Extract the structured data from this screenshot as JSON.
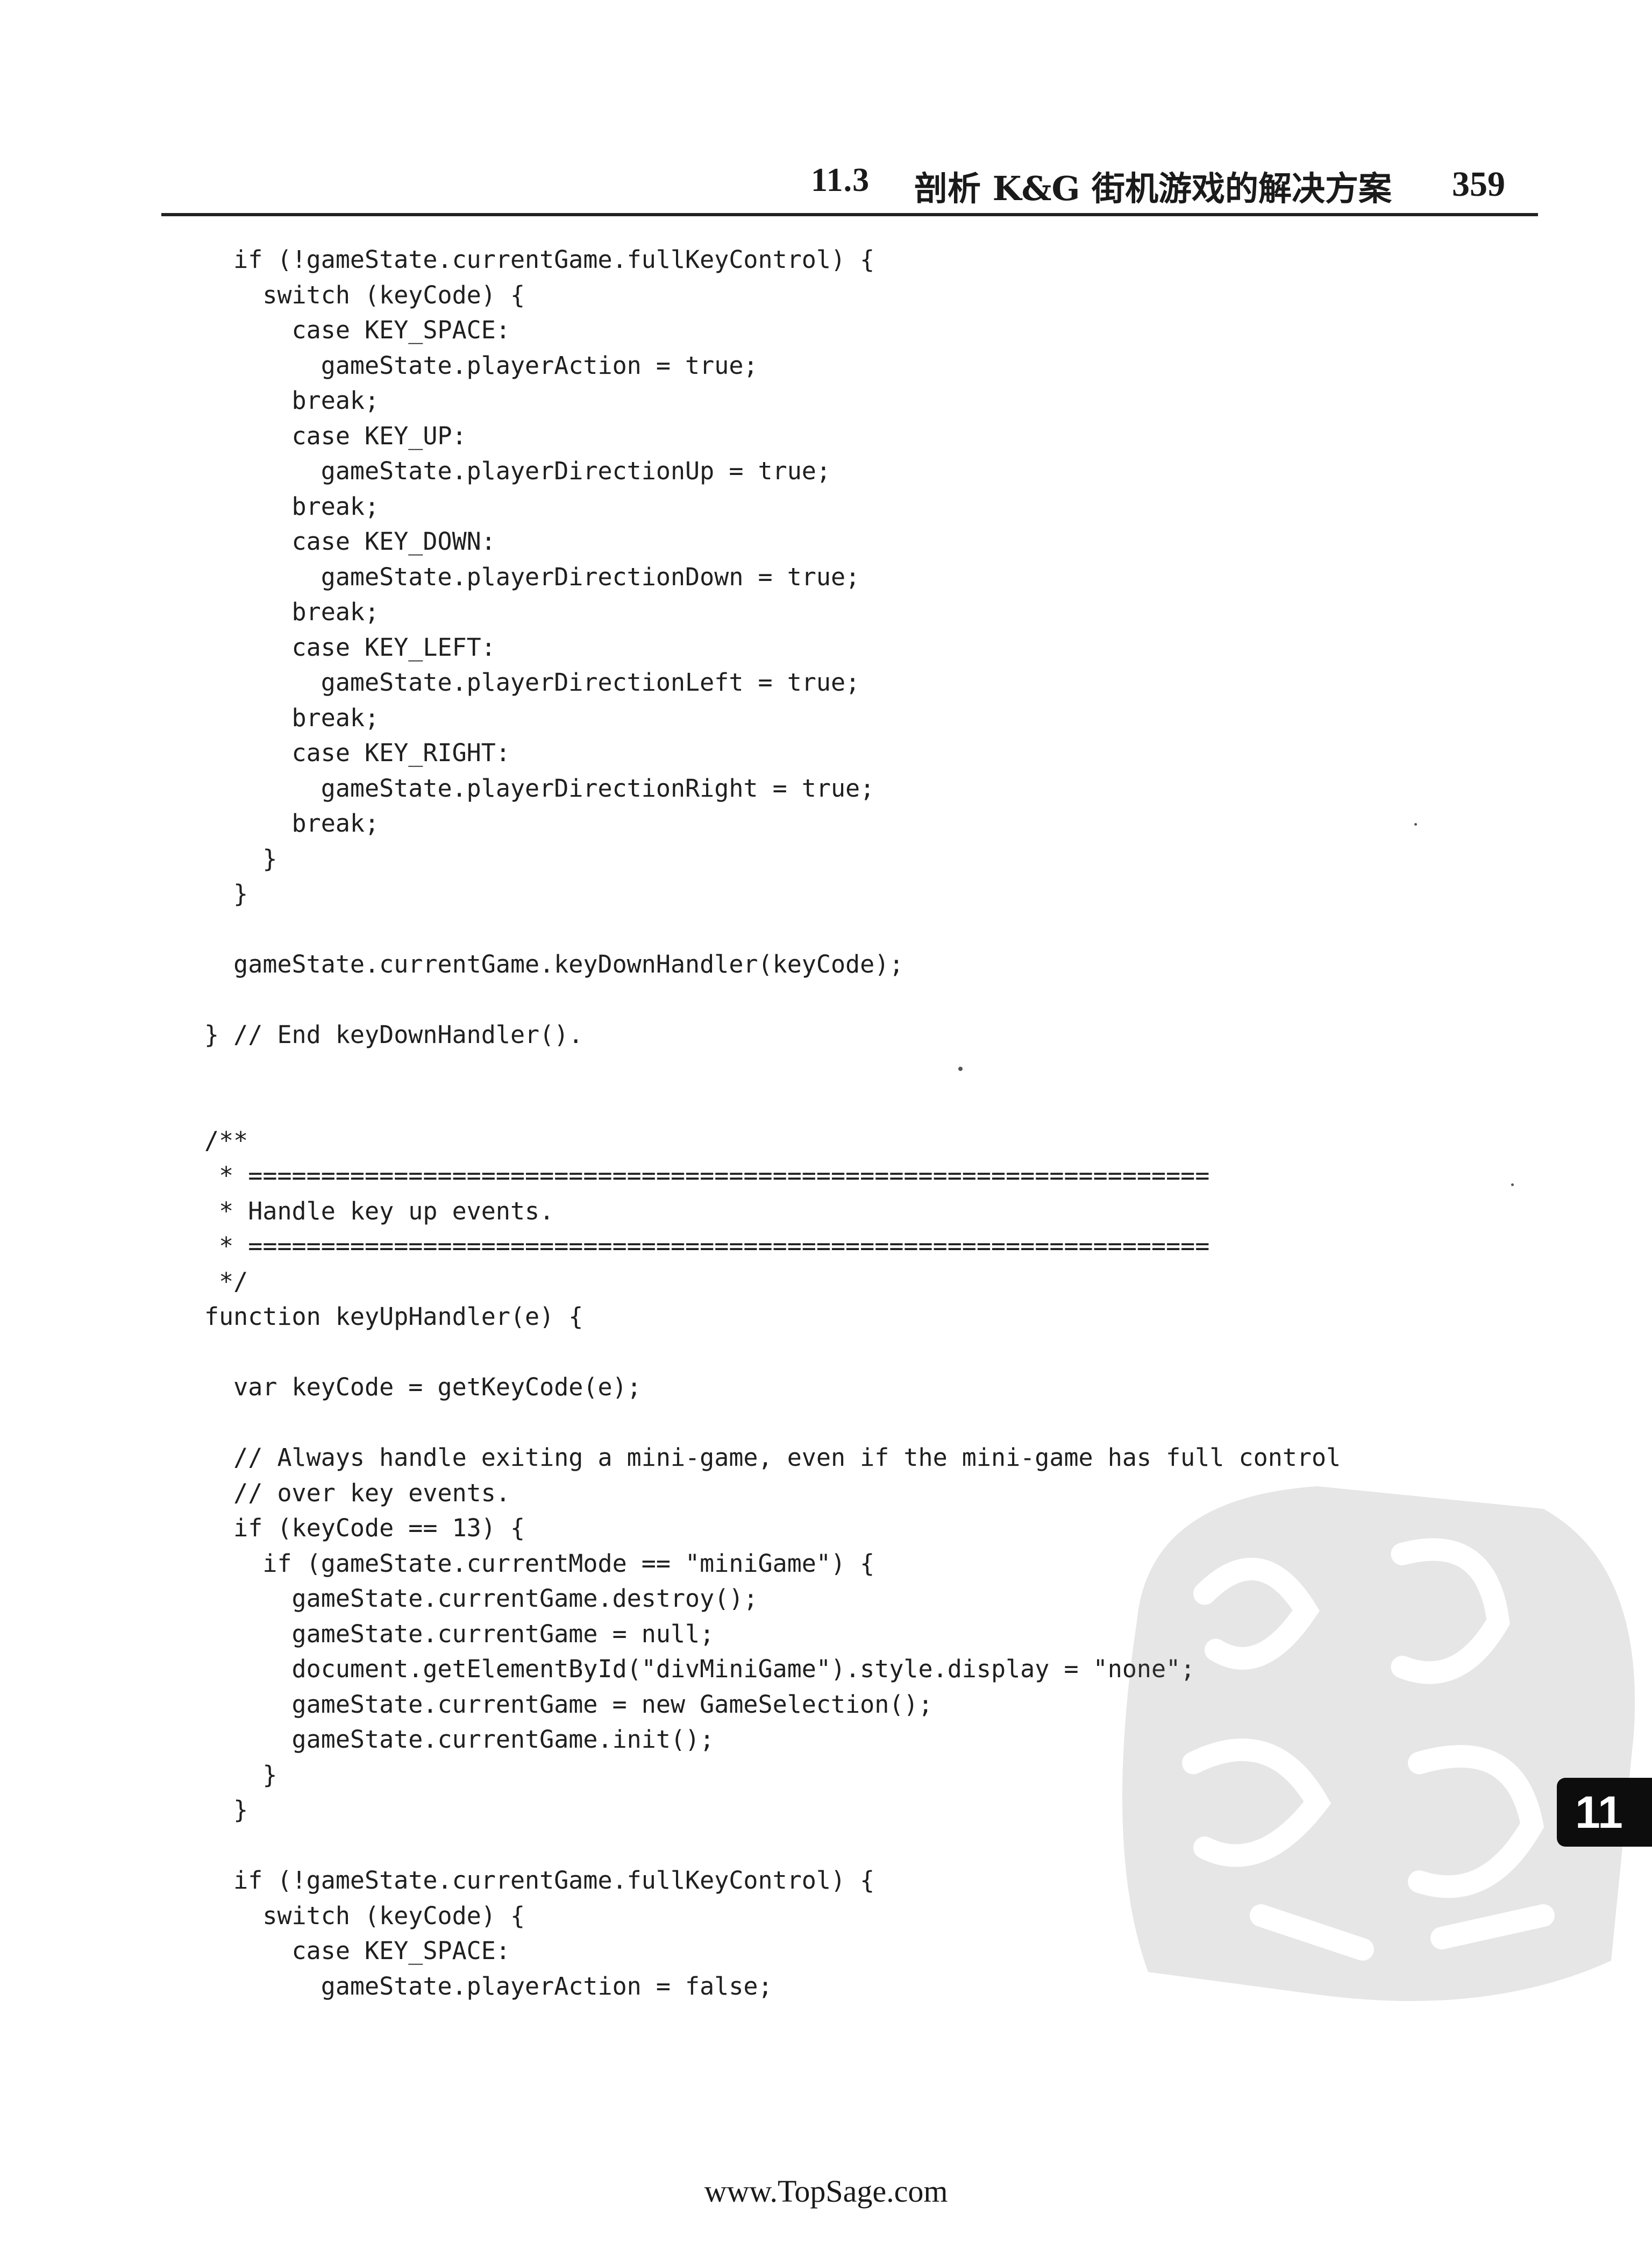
{
  "header": {
    "section_number": "11.3",
    "section_title": "剖析 K&G 街机游戏的解决方案",
    "page_number": "359"
  },
  "code_lines": [
    "  if (!gameState.currentGame.fullKeyControl) {",
    "    switch (keyCode) {",
    "      case KEY_SPACE:",
    "        gameState.playerAction = true;",
    "      break;",
    "      case KEY_UP:",
    "        gameState.playerDirectionUp = true;",
    "      break;",
    "      case KEY_DOWN:",
    "        gameState.playerDirectionDown = true;",
    "      break;",
    "      case KEY_LEFT:",
    "        gameState.playerDirectionLeft = true;",
    "      break;",
    "      case KEY_RIGHT:",
    "        gameState.playerDirectionRight = true;",
    "      break;",
    "    }",
    "  }",
    "",
    "  gameState.currentGame.keyDownHandler(keyCode);",
    "",
    "} // End keyDownHandler().",
    "",
    "",
    "/**",
    " * ==================================================================",
    " * Handle key up events.",
    " * ==================================================================",
    " */",
    "function keyUpHandler(e) {",
    "",
    "  var keyCode = getKeyCode(e);",
    "",
    "  // Always handle exiting a mini-game, even if the mini-game has full control",
    "  // over key events.",
    "  if (keyCode == 13) {",
    "    if (gameState.currentMode == \"miniGame\") {",
    "      gameState.currentGame.destroy();",
    "      gameState.currentGame = null;",
    "      document.getElementById(\"divMiniGame\").style.display = \"none\";",
    "      gameState.currentGame = new GameSelection();",
    "      gameState.currentGame.init();",
    "    }",
    "  }",
    "",
    "  if (!gameState.currentGame.fullKeyControl) {",
    "    switch (keyCode) {",
    "      case KEY_SPACE:",
    "        gameState.playerAction = false;"
  ],
  "chapter_tab": "11",
  "footer": {
    "url": "www.TopSage.com"
  }
}
